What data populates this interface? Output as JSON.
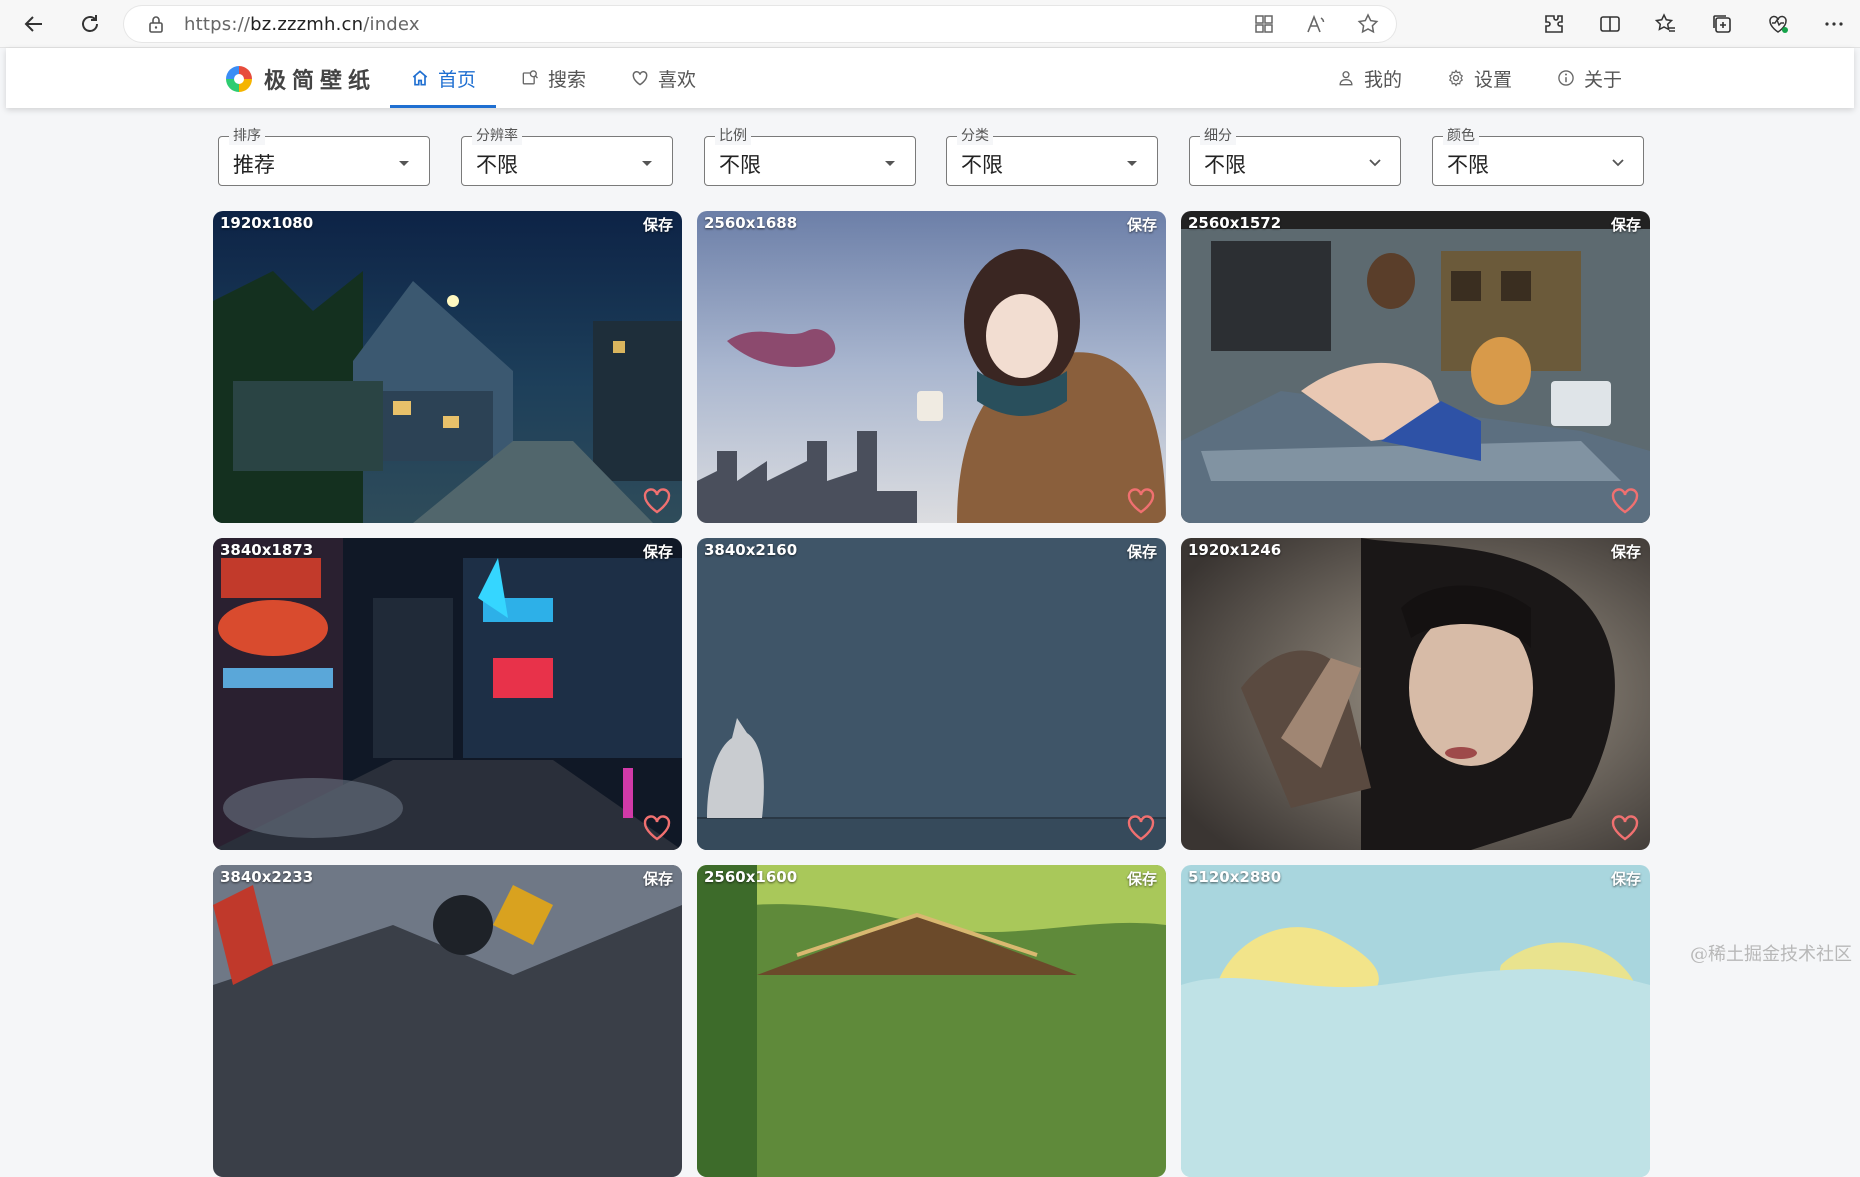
{
  "browser": {
    "url_scheme": "https://",
    "url_host": "bz.zzzmh.cn",
    "url_path": "/index"
  },
  "app": {
    "logo_text": "极简壁纸",
    "nav": [
      {
        "label": "首页",
        "icon": "home-icon",
        "active": true
      },
      {
        "label": "搜索",
        "icon": "search-icon",
        "active": false
      },
      {
        "label": "喜欢",
        "icon": "heart-outline-icon",
        "active": false
      }
    ],
    "nav_right": [
      {
        "label": "我的",
        "icon": "user-icon"
      },
      {
        "label": "设置",
        "icon": "gear-icon"
      },
      {
        "label": "关于",
        "icon": "info-icon"
      }
    ],
    "accent_color": "#1f6fd1"
  },
  "filters": [
    {
      "label": "排序",
      "value": "推荐"
    },
    {
      "label": "分辨率",
      "value": "不限"
    },
    {
      "label": "比例",
      "value": "不限"
    },
    {
      "label": "分类",
      "value": "不限"
    },
    {
      "label": "细分",
      "value": "不限"
    },
    {
      "label": "颜色",
      "value": "不限"
    }
  ],
  "wallpapers": [
    {
      "resolution": "1920x1080",
      "save": "保存"
    },
    {
      "resolution": "2560x1688",
      "save": "保存"
    },
    {
      "resolution": "2560x1572",
      "save": "保存"
    },
    {
      "resolution": "3840x1873",
      "save": "保存"
    },
    {
      "resolution": "3840x2160",
      "save": "保存"
    },
    {
      "resolution": "1920x1246",
      "save": "保存"
    },
    {
      "resolution": "3840x2233",
      "save": "保存"
    },
    {
      "resolution": "2560x1600",
      "save": "保存"
    },
    {
      "resolution": "5120x2880",
      "save": "保存"
    }
  ],
  "watermark": "@稀土掘金技术社区",
  "heart_color": "#f07070"
}
